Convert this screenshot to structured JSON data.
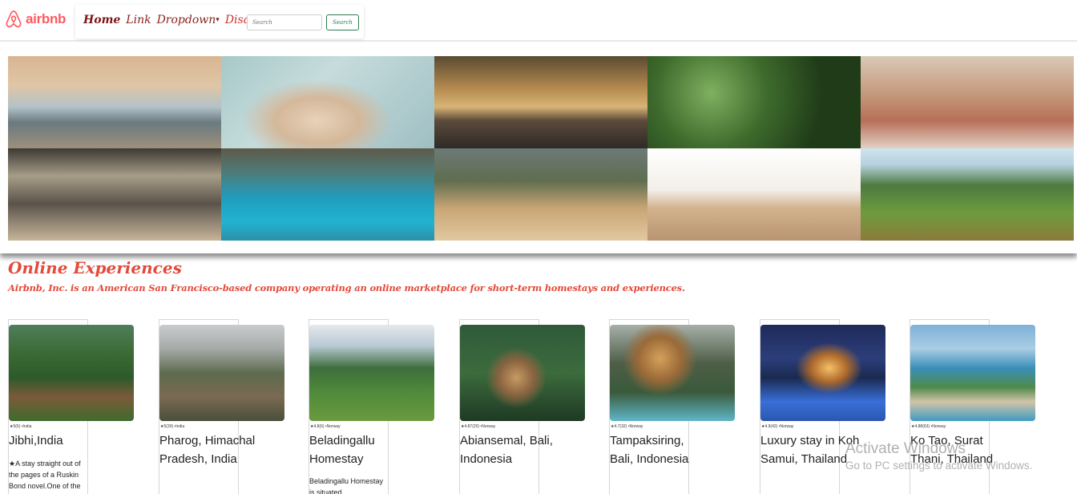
{
  "navbar": {
    "brand_text": "airbnb",
    "links": [
      {
        "label": "Home"
      },
      {
        "label": "Link"
      },
      {
        "label": "Dropdown"
      },
      {
        "label": "Disabled"
      }
    ],
    "search": {
      "placeholder": "Search",
      "button_label": "Search"
    },
    "brand_color": "#ff5a5f"
  },
  "hero": {
    "tiles": [
      "desert-dunes",
      "hands-pouring-sand",
      "sunset-over-water",
      "forest-path",
      "friends-cooking",
      "sand-texture",
      "turquoise-bay-boats",
      "mountain-trail-walk",
      "white-desert",
      "green-countryside"
    ]
  },
  "section": {
    "title": "Online Experiences",
    "subtitle": "Airbnb, Inc. is an American San Francisco-based company operating an online marketplace for short-term homestays and experiences.",
    "accent_color": "#e24a3a"
  },
  "cards": [
    {
      "rating": "★5(6) •India",
      "title": "Jibhi,India",
      "desc": "★A stay straight out of the pages of a Ruskin Bond novel.One of the"
    },
    {
      "rating": "★5(30) •India",
      "title": "Pharog, Himachal Pradesh, India",
      "desc": ""
    },
    {
      "rating": "★4.8(6) •Norway",
      "title": "Beladingallu Homestay",
      "desc": "Beladingallu Homestay is situated"
    },
    {
      "rating": "★4.87(20) •Norway",
      "title": "Abiansemal, Bali, Indonesia",
      "desc": ""
    },
    {
      "rating": "★4.7(32) •Norway",
      "title": "Tampaksiring, Bali, Indonesia",
      "desc": ""
    },
    {
      "rating": "★4.9(42) •Norway",
      "title": "Luxury stay in Koh Samui, Thailand",
      "desc": ""
    },
    {
      "rating": "★4.88(63) •Norway",
      "title": "Ko Tao, Surat Thani, Thailand",
      "desc": ""
    }
  ],
  "watermark": {
    "title": "Activate Windows",
    "subtitle": "Go to PC settings to activate Windows."
  }
}
